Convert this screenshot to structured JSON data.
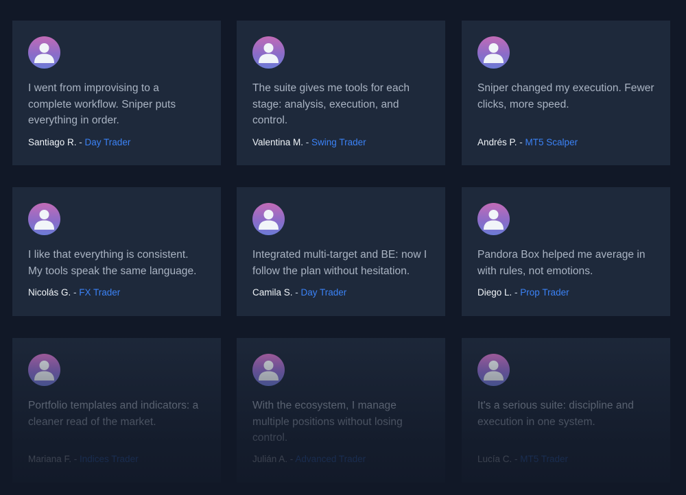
{
  "testimonials": [
    {
      "quote": "I went from improvising to a complete workflow. Sniper puts everything in order.",
      "name": "Santiago R.",
      "separator": " - ",
      "role": "Day Trader"
    },
    {
      "quote": "The suite gives me tools for each stage: analysis, execution, and control.",
      "name": "Valentina M.",
      "separator": " - ",
      "role": "Swing Trader"
    },
    {
      "quote": "Sniper changed my execution. Fewer clicks, more speed.",
      "name": "Andrés P.",
      "separator": " - ",
      "role": "MT5 Scalper"
    },
    {
      "quote": "I like that everything is consistent. My tools speak the same language.",
      "name": "Nicolás G.",
      "separator": " - ",
      "role": "FX Trader"
    },
    {
      "quote": "Integrated multi-target and BE: now I follow the plan without hesitation.",
      "name": "Camila S.",
      "separator": " - ",
      "role": "Day Trader"
    },
    {
      "quote": "Pandora Box helped me average in with rules, not emotions.",
      "name": "Diego L.",
      "separator": " - ",
      "role": "Prop Trader"
    },
    {
      "quote": "Portfolio templates and indicators: a cleaner read of the market.",
      "name": "Mariana F.",
      "separator": " - ",
      "role": "Indices Trader"
    },
    {
      "quote": "With the ecosystem, I manage multiple positions without losing control.",
      "name": "Julián A.",
      "separator": " - ",
      "role": "Advanced Trader"
    },
    {
      "quote": "It's a serious suite: discipline and execution in one system.",
      "name": "Lucía C.",
      "separator": " - ",
      "role": "MT5 Trader"
    }
  ],
  "colors": {
    "background": "#111827",
    "card": "#1e293b",
    "accent": "#3b82f6",
    "quote_text": "#aab4c3"
  },
  "icons": {
    "avatar": "user-avatar-icon"
  }
}
